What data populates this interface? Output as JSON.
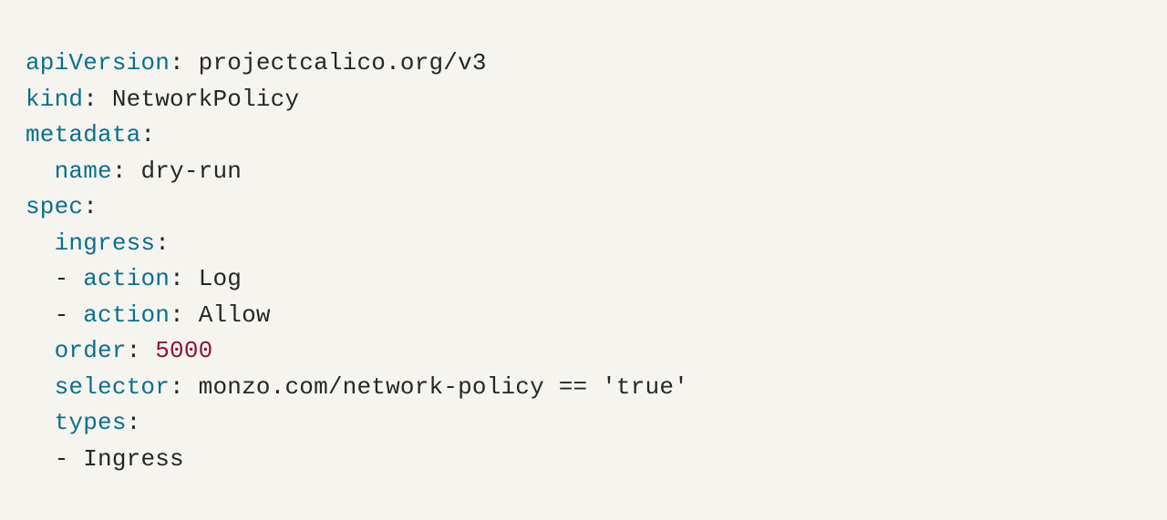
{
  "yaml": {
    "apiVersion": {
      "key": "apiVersion",
      "value": "projectcalico.org/v3"
    },
    "kind": {
      "key": "kind",
      "value": "NetworkPolicy"
    },
    "metadata": {
      "key": "metadata"
    },
    "name": {
      "key": "name",
      "value": "dry-run"
    },
    "spec": {
      "key": "spec"
    },
    "ingress": {
      "key": "ingress"
    },
    "action1": {
      "key": "action",
      "value": "Log"
    },
    "action2": {
      "key": "action",
      "value": "Allow"
    },
    "order": {
      "key": "order",
      "value": "5000"
    },
    "selector": {
      "key": "selector",
      "value": "monzo.com/network-policy == 'true'"
    },
    "types": {
      "key": "types"
    },
    "typesItem": {
      "value": "Ingress"
    }
  },
  "glyph": {
    "colon": ":",
    "dash": "-"
  }
}
